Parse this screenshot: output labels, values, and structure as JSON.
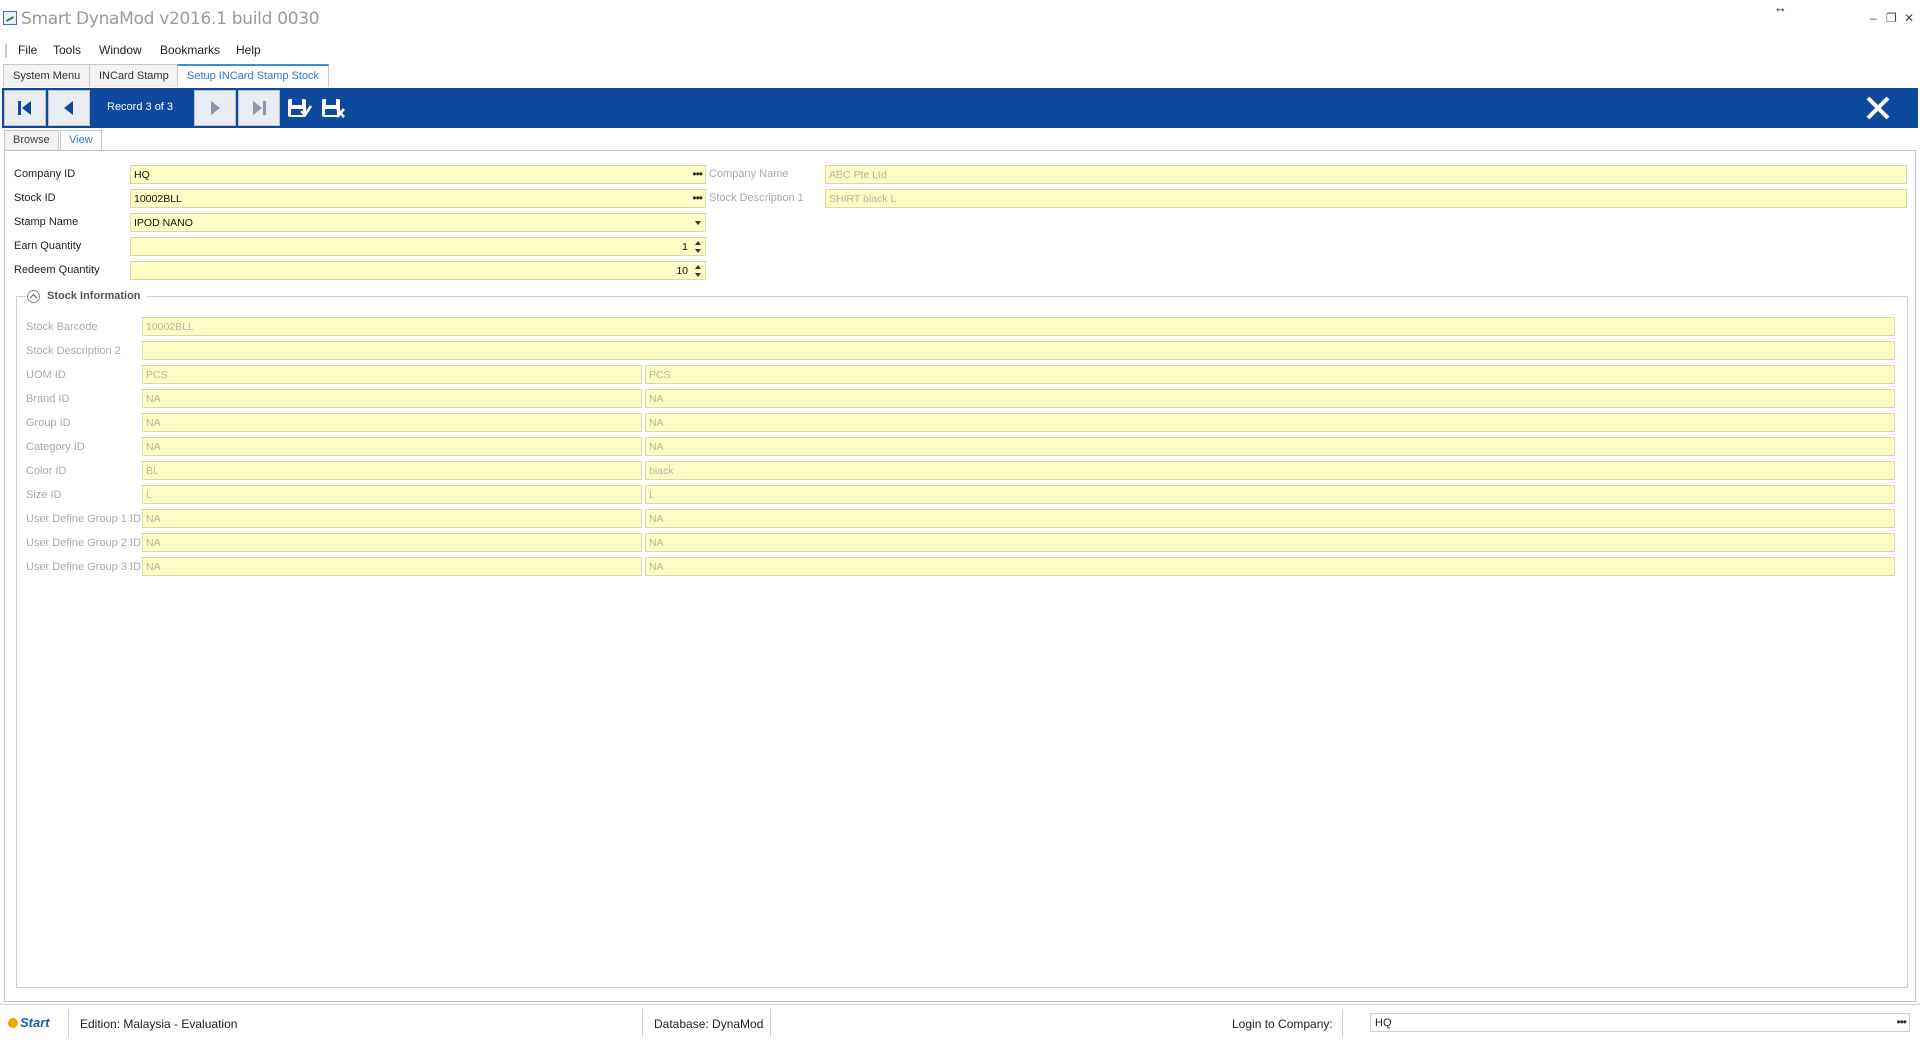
{
  "window": {
    "title": "Smart DynaMod v2016.1 build 0030"
  },
  "menu": [
    "File",
    "Tools",
    "Window",
    "Bookmarks",
    "Help"
  ],
  "doc_tabs": [
    "System Menu",
    "INCard Stamp",
    "Setup INCard Stamp Stock"
  ],
  "toolbar": {
    "record_label": "Record 3 of 3"
  },
  "view_tabs": [
    "Browse",
    "View"
  ],
  "form": {
    "company_id_label": "Company ID",
    "company_id": "HQ",
    "company_name_label": "Company Name",
    "company_name": "ABC Pte Ltd",
    "stock_id_label": "Stock ID",
    "stock_id": "10002BLL",
    "stock_desc1_label": "Stock Description 1",
    "stock_desc1": "SHIRT black L",
    "stamp_name_label": "Stamp Name",
    "stamp_name": "IPOD NANO",
    "earn_qty_label": "Earn Quantity",
    "earn_qty": "1",
    "redeem_qty_label": "Redeem Quantity",
    "redeem_qty": "10"
  },
  "stock_info": {
    "title": "Stock Information",
    "rows": [
      {
        "label": "Stock Barcode",
        "value": "10002BLL"
      },
      {
        "label": "Stock Description 2",
        "value": ""
      },
      {
        "label": "UOM ID",
        "code": "PCS",
        "desc": "PCS"
      },
      {
        "label": "Brand ID",
        "code": "NA",
        "desc": "NA"
      },
      {
        "label": "Group ID",
        "code": "NA",
        "desc": "NA"
      },
      {
        "label": "Category ID",
        "code": "NA",
        "desc": "NA"
      },
      {
        "label": "Color ID",
        "code": "BL",
        "desc": "black"
      },
      {
        "label": "Size ID",
        "code": "L",
        "desc": "L"
      },
      {
        "label": "User Define Group 1 ID",
        "code": "NA",
        "desc": "NA"
      },
      {
        "label": "User Define Group 2 ID",
        "code": "NA",
        "desc": "NA"
      },
      {
        "label": "User Define Group 3 ID",
        "code": "NA",
        "desc": "NA"
      }
    ]
  },
  "status": {
    "logo": "Start",
    "edition": "Edition: Malaysia - Evaluation",
    "database": "Database: DynaMod",
    "login_label": "Login to Company:",
    "login_company": "HQ"
  },
  "colors": {
    "toolbar": "#0d4a9e",
    "field_bg": "#fdfdc4",
    "active_tab": "#2a7bd0"
  }
}
